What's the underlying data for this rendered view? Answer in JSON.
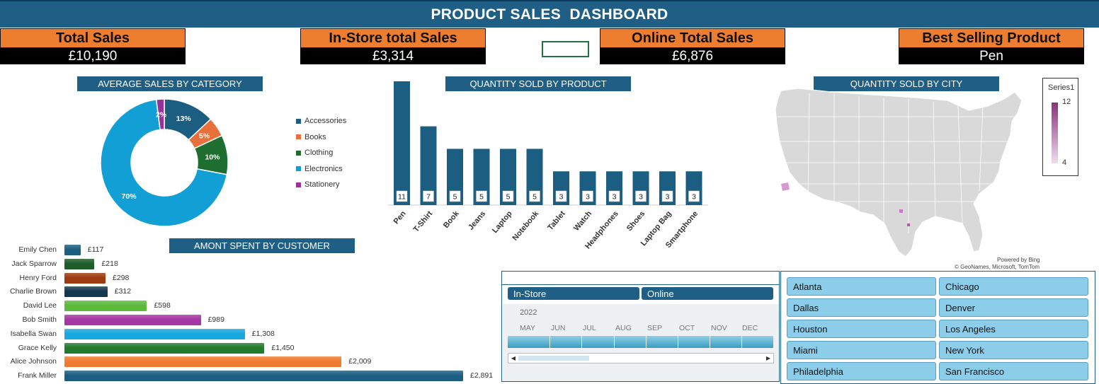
{
  "header": {
    "title": "PRODUCT SALES  DASHBOARD"
  },
  "kpis": [
    {
      "label": "Total Sales",
      "value": "£10,190"
    },
    {
      "label": "In-Store total Sales",
      "value": "£3,314"
    },
    {
      "label": "Online Total Sales",
      "value": "£6,876"
    },
    {
      "label": "Best Selling Product",
      "value": "Pen"
    }
  ],
  "sections": {
    "avg_category": "AVERAGE SALES BY CATEGORY",
    "qty_product": "QUANTITY SOLD BY PRODUCT",
    "qty_city": "QUANTITY SOLD BY CITY",
    "customer": "AMONT SPENT BY CUSTOMER"
  },
  "colors": {
    "banner": "#1f5f86",
    "kpi_head": "#ee7e2f",
    "accessories": "#1b5e82",
    "books": "#e8703a",
    "clothing": "#1e6e2f",
    "electronics": "#129fd6",
    "stationery": "#95319a"
  },
  "chart_data": [
    {
      "type": "pie",
      "categories": [
        "Accessories",
        "Books",
        "Clothing",
        "Electronics",
        "Stationery"
      ],
      "values": [
        13,
        5,
        10,
        70,
        2
      ],
      "labels": [
        "13%",
        "5%",
        "10%",
        "70%",
        "2%"
      ]
    },
    {
      "type": "bar",
      "categories": [
        "Pen",
        "T-Shirt",
        "Book",
        "Jeans",
        "Laptop",
        "Notebook",
        "Tablet",
        "Watch",
        "Headphones",
        "Shoes",
        "Laptop Bag",
        "Smartphone"
      ],
      "values": [
        11,
        7,
        5,
        5,
        5,
        5,
        3,
        3,
        3,
        3,
        3,
        3
      ],
      "ylim": [
        0,
        11
      ]
    },
    {
      "type": "bar",
      "orientation": "horizontal",
      "categories": [
        "Emily Chen",
        "Jack Sparrow",
        "Henry Ford",
        "Charlie Brown",
        "David Lee",
        "Bob Smith",
        "Isabella Swan",
        "Grace Kelly",
        "Alice Johnson",
        "Frank Miller"
      ],
      "values": [
        117,
        218,
        298,
        312,
        598,
        989,
        1308,
        1450,
        2009,
        2891
      ],
      "labels": [
        "£117",
        "£218",
        "£298",
        "£312",
        "£598",
        "£989",
        "£1,308",
        "£1,450",
        "£2,009",
        "£2,891"
      ],
      "colors": [
        "#1b5e82",
        "#1e5c2a",
        "#9e3a12",
        "#14384f",
        "#5cb93c",
        "#a636a4",
        "#19a7e0",
        "#237a2d",
        "#ef7a32",
        "#1b5e82"
      ]
    }
  ],
  "map": {
    "legend_title": "Series1",
    "legend_max": "12",
    "legend_min": "4",
    "credit_1": "Powered by Bing",
    "credit_2": "© GeoNames, Microsoft, TomTom"
  },
  "slicer": {
    "channels": [
      "In-Store",
      "Online"
    ],
    "year": "2022",
    "months": [
      "MAY",
      "JUN",
      "JUL",
      "AUG",
      "SEP",
      "OCT",
      "NOV",
      "DEC"
    ]
  },
  "cities": [
    "Atlanta",
    "Chicago",
    "Dallas",
    "Denver",
    "Houston",
    "Los Angeles",
    "Miami",
    "New York",
    "Philadelphia",
    "San Francisco"
  ]
}
